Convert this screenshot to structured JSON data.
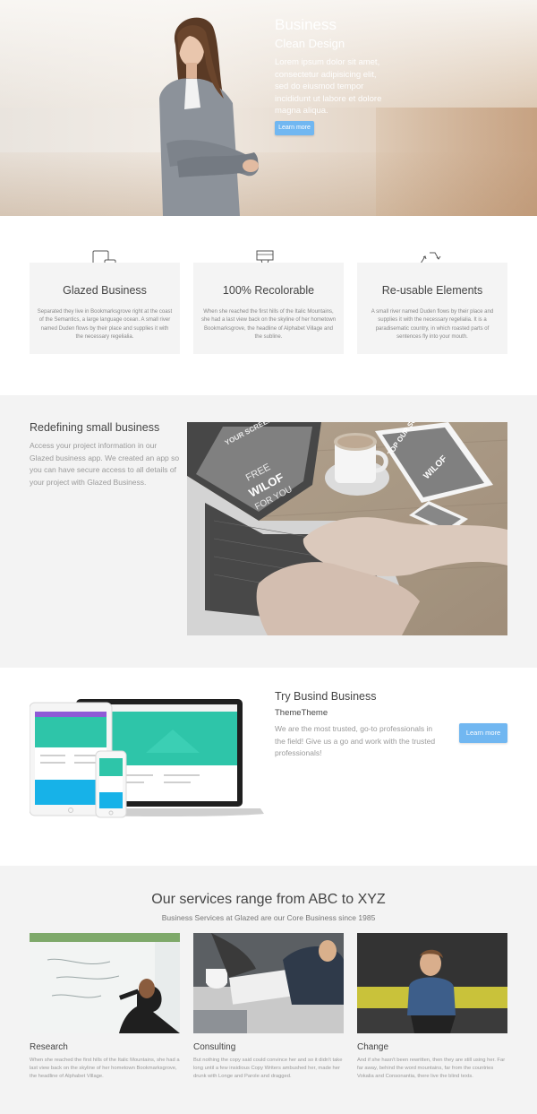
{
  "hero": {
    "title": "Business",
    "subtitle": "Clean Design",
    "body": "Lorem ipsum dolor sit amet, consectetur adipisicing elit, sed do eiusmod tempor incididunt ut labore et dolore magna aliqua.",
    "button": "Learn more"
  },
  "features": [
    {
      "icon": "tablet-phone-icon",
      "title": "Glazed Business",
      "body": "Separated they live in Bookmarksgrove right at the coast of the Semantics, a large language ocean. A small river named Duden flows by their place and supplies it with the necessary regelialia."
    },
    {
      "icon": "paint-brush-icon",
      "title": "100% Recolorable",
      "body": "When she reached the first hills of the Italic Mountains, she had a last view back on the skyline of her hometown Bookmarksgrove, the headline of Alphabet Village and the subline."
    },
    {
      "icon": "recycle-icon",
      "title": "Re-usable Elements",
      "body": "A small river named Duden flows by their place and supplies it with the necessary regelialia. It is a paradisematic country, in which roasted parts of sentences fly into your mouth."
    }
  ],
  "redefining": {
    "title": "Redefining small business",
    "body": "Access your project information in our Glazed business app. We created an app so you can have secure access to all details of your project with Glazed Business.",
    "screen_text": [
      "FREE",
      "WILOF",
      "FOR YOU",
      "YOUR SCREEN HERE",
      "TOP OUR SCREEN HERE"
    ]
  },
  "try": {
    "title": "Try Busind Business",
    "subtitle": "ThemeTheme",
    "body": "We are the most trusted, go-to professionals in the field! Give us a go and work with the trusted professionals!",
    "button": "Learn more"
  },
  "services": {
    "title": "Our services range from ABC to XYZ",
    "subtitle": "Business Services at Glazed are our Core Business since 1985",
    "items": [
      {
        "name": "Research",
        "body": "When she reached the first hills of the Italic Mountains, she had a last view back on the skyline of her hometown Bookmarksgrove, the headline of Alphabet Village."
      },
      {
        "name": "Consulting",
        "body": "But nothing the copy said could convince her and so it didn't take long until a few insidious Copy Writers ambushed her, made her drunk with Longe and Parole and dragged."
      },
      {
        "name": "Change",
        "body": "And if she hasn't been rewritten, then they are still using her. Far far away, behind the word mountains, far from the countries Vokalia and Consonantia, there live the blind texts."
      }
    ]
  },
  "colors": {
    "accent": "#71b7f1",
    "section_gray": "#f3f3f3",
    "card_gray": "#f4f4f4"
  }
}
